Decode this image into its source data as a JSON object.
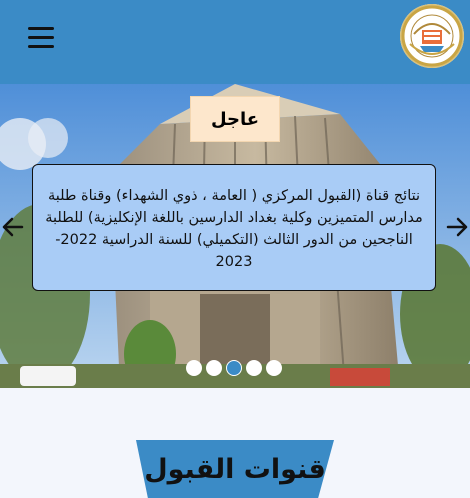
{
  "header": {
    "menu_icon": "hamburger-menu-icon",
    "logo_icon": "ministry-seal-logo"
  },
  "hero": {
    "badge_label": "عاجل",
    "news_text": "نتائج قناة (القبول المركزي ( العامة ، ذوي الشهداء) وقناة طلبة مدارس المتميزين وكلية بغداد الدارسين باللغة الإنكليزية) للطلبة الناجحين من الدور الثالث (التكميلي) للسنة الدراسية 2022-2023",
    "prev_icon": "arrow-left-icon",
    "next_icon": "arrow-right-icon",
    "dots_count": 5,
    "active_dot": 3
  },
  "section": {
    "title": "قنوات القبول"
  },
  "colors": {
    "header_bg": "#3b8bc6",
    "news_bg": "#a9ccf6",
    "badge_bg": "#fde7cc",
    "section_bg": "#3b8bc6",
    "page_bg": "#f3f6fc"
  }
}
